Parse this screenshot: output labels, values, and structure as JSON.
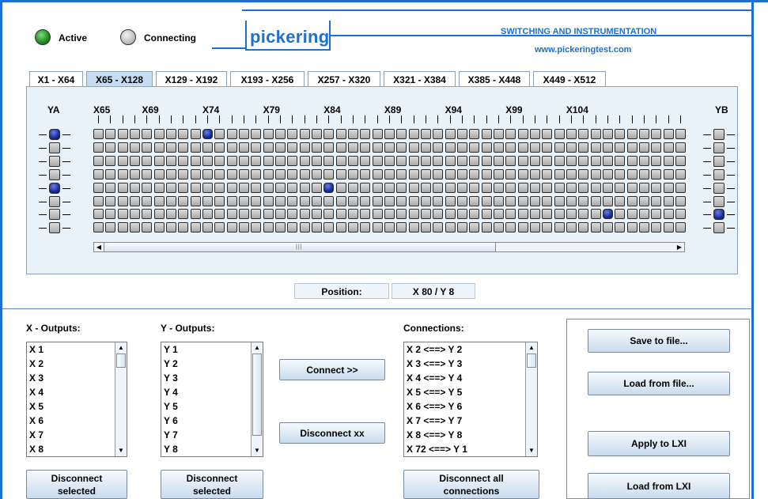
{
  "header": {
    "status_active": "Active",
    "status_connecting": "Connecting",
    "logo": "pickering",
    "tagline": "SWITCHING AND INSTRUMENTATION",
    "website": "www.pickeringtest.com"
  },
  "tabs": [
    "X1 - X64",
    "X65 - X128",
    "X129 - X192",
    "X193 - X256",
    "X257 - X320",
    "X321 - X384",
    "X385 - X448",
    "X449 - X512"
  ],
  "selected_tab": 1,
  "matrix": {
    "ya_label": "YA",
    "yb_label": "YB",
    "column_labels": [
      "X65",
      "X69",
      "X74",
      "X79",
      "X84",
      "X89",
      "X94",
      "X99",
      "X104"
    ],
    "rows": 8,
    "visible_cols": 49,
    "active_cells": [
      [
        0,
        9
      ],
      [
        4,
        19
      ],
      [
        6,
        42
      ]
    ],
    "ya_active": [
      0,
      4
    ],
    "yb_active": [
      6
    ]
  },
  "position": {
    "label": "Position:",
    "value": "X 80 / Y 8"
  },
  "x_outputs": {
    "label": "X - Outputs:",
    "items": [
      "X 1",
      "X 2",
      "X 3",
      "X 4",
      "X 5",
      "X 6",
      "X 7",
      "X 8"
    ]
  },
  "y_outputs": {
    "label": "Y - Outputs:",
    "items": [
      "Y 1",
      "Y 2",
      "Y 3",
      "Y 4",
      "Y 5",
      "Y 6",
      "Y 7",
      "Y 8"
    ]
  },
  "connections": {
    "label": "Connections:",
    "items": [
      "X 2 <==> Y 2",
      "X 3 <==> Y 3",
      "X 4 <==> Y 4",
      "X 5 <==> Y 5",
      "X 6 <==> Y 6",
      "X 7 <==> Y 7",
      "X 8 <==> Y 8",
      "X 72 <==> Y 1"
    ]
  },
  "buttons": {
    "connect": "Connect  >>",
    "disconnect": "Disconnect  xx",
    "disconnect_x": "Disconnect\nselected",
    "disconnect_y": "Disconnect\nselected",
    "disconnect_all": "Disconnect all\nconnections",
    "save_file": "Save to file...",
    "load_file": "Load from file...",
    "apply_lxi": "Apply to LXI",
    "load_lxi": "Load from LXI"
  },
  "colors": {
    "brand_blue": "#1f6fd1",
    "active_led": "#1e8a1e",
    "switch_on": "#1a2da0"
  }
}
